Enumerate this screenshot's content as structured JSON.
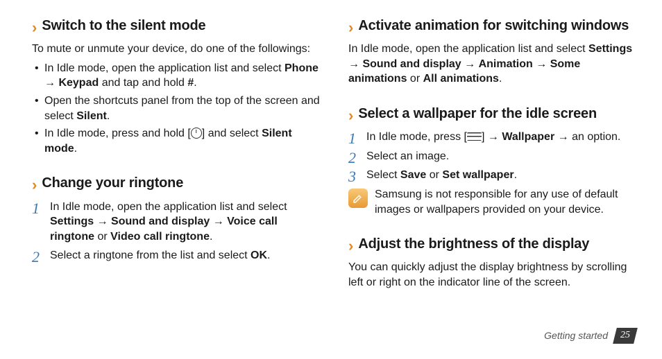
{
  "left": {
    "s1": {
      "title": "Switch to the silent mode",
      "intro": "To mute or unmute your device, do one of the followings:",
      "b1a": "In Idle mode, open the application list and select ",
      "b1_phone": "Phone",
      "b1_arrow": " → ",
      "b1_keypad": "Keypad",
      "b1b": " and tap and hold ",
      "b1_hash": "#",
      "b1c": ".",
      "b2a": "Open the shortcuts panel from the top of the screen and select ",
      "b2_silent": "Silent",
      "b2b": ".",
      "b3a": "In Idle mode, press and hold [",
      "b3b": "] and select ",
      "b3_silent": "Silent mode",
      "b3c": "."
    },
    "s2": {
      "title": "Change your ringtone",
      "st1a": "In Idle mode, open the application list and select ",
      "st1_settings": "Settings",
      "arrow": " → ",
      "st1_sound": "Sound and display",
      "st1_voice": "Voice call ringtone",
      "st1_or": " or ",
      "st1_video": "Video call ringtone",
      "st1b": ".",
      "st2a": "Select a ringtone from the list and select ",
      "st2_ok": "OK",
      "st2b": "."
    }
  },
  "right": {
    "s1": {
      "title": "Activate animation for switching windows",
      "p1a": "In Idle mode, open the application list and select ",
      "settings": "Settings",
      "arrow": " → ",
      "sound": "Sound and display",
      "anim": "Animation",
      "some": "Some animations",
      "or": " or ",
      "all": "All animations",
      "end": "."
    },
    "s2": {
      "title": "Select a wallpaper for the idle screen",
      "st1a": "In Idle mode, press [",
      "st1b": "] → ",
      "wallpaper": "Wallpaper",
      "st1c": " → an option.",
      "st2": "Select an image.",
      "st3a": "Select ",
      "save": "Save",
      "st3or": " or ",
      "setwp": "Set wallpaper",
      "st3b": ".",
      "note": "Samsung is not responsible for any use of default images or wallpapers provided on your device."
    },
    "s3": {
      "title": "Adjust the brightness of the display",
      "p": "You can quickly adjust the display brightness by scrolling left or right on the indicator line of the screen."
    }
  },
  "footer": {
    "section": "Getting started",
    "page": "25"
  },
  "nums": {
    "n1": "1",
    "n2": "2",
    "n3": "3"
  }
}
